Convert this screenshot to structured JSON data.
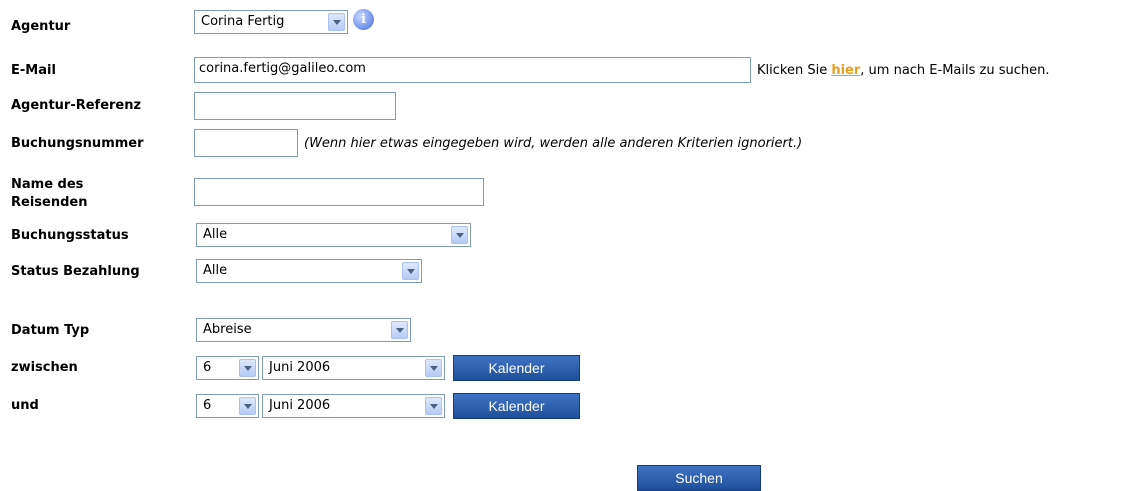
{
  "labels": {
    "agentur": "Agentur",
    "email": "E-Mail",
    "agentur_referenz": "Agentur-Referenz",
    "buchungsnummer": "Buchungsnummer",
    "name_reisenden_line1": "Name des",
    "name_reisenden_line2": "Reisenden",
    "buchungsstatus": "Buchungsstatus",
    "status_bezahlung": "Status Bezahlung",
    "datum_typ": "Datum Typ",
    "zwischen": "zwischen",
    "und": "und"
  },
  "fields": {
    "agentur_value": "Corina Fertig",
    "email_value": "corina.fertig@galileo.com",
    "agentur_referenz_value": "",
    "buchungsnummer_value": "",
    "name_reisenden_value": "",
    "buchungsstatus_value": "Alle",
    "status_bezahlung_value": "Alle",
    "datum_typ_value": "Abreise",
    "zwischen_day": "6",
    "zwischen_month": "Juni 2006",
    "und_day": "6",
    "und_month": "Juni 2006"
  },
  "hints": {
    "email_prefix": "Klicken Sie ",
    "email_link": "hier",
    "email_suffix": ", um nach E-Mails zu suchen.",
    "buchungsnummer_note": "(Wenn hier etwas eingegeben wird, werden alle anderen Kriterien ignoriert.)"
  },
  "buttons": {
    "kalender": "Kalender",
    "suchen": "Suchen"
  },
  "icons": {
    "info": "info-icon",
    "info_glyph": "i"
  },
  "colors": {
    "button_bg": "#2a5fae",
    "link": "#e8a11e",
    "border": "#7f9db9"
  }
}
